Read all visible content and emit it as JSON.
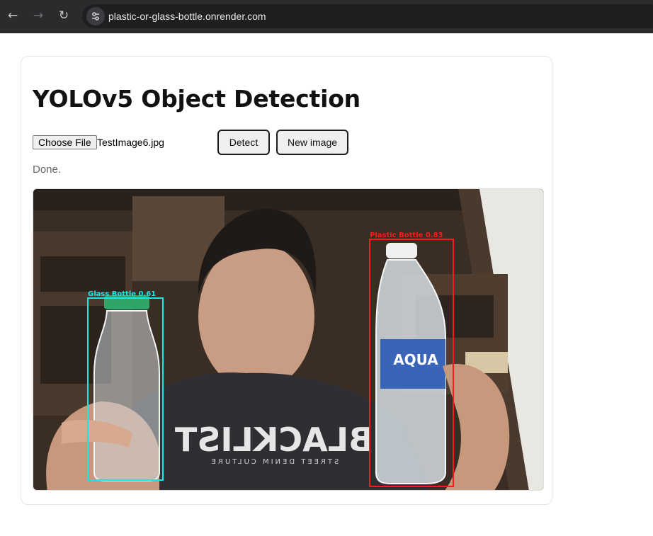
{
  "browser": {
    "url": "plastic-or-glass-bottle.onrender.com",
    "back_icon": "←",
    "forward_icon": "→",
    "reload_icon": "↻"
  },
  "app": {
    "title": "YOLOv5 Object Detection",
    "choose_file_label": "Choose File",
    "file_name": "TestImage6.jpg",
    "detect_label": "Detect",
    "new_image_label": "New image",
    "status": "Done."
  },
  "detections": [
    {
      "label": "Glass Bottle 0.61",
      "color": "#19e6e6"
    },
    {
      "label": "Plastic Bottle 0.83",
      "color": "#ff1a1a"
    }
  ],
  "shirt_text": "BLACKLIST",
  "shirt_subtext": "STREET DENIM CULTURE"
}
